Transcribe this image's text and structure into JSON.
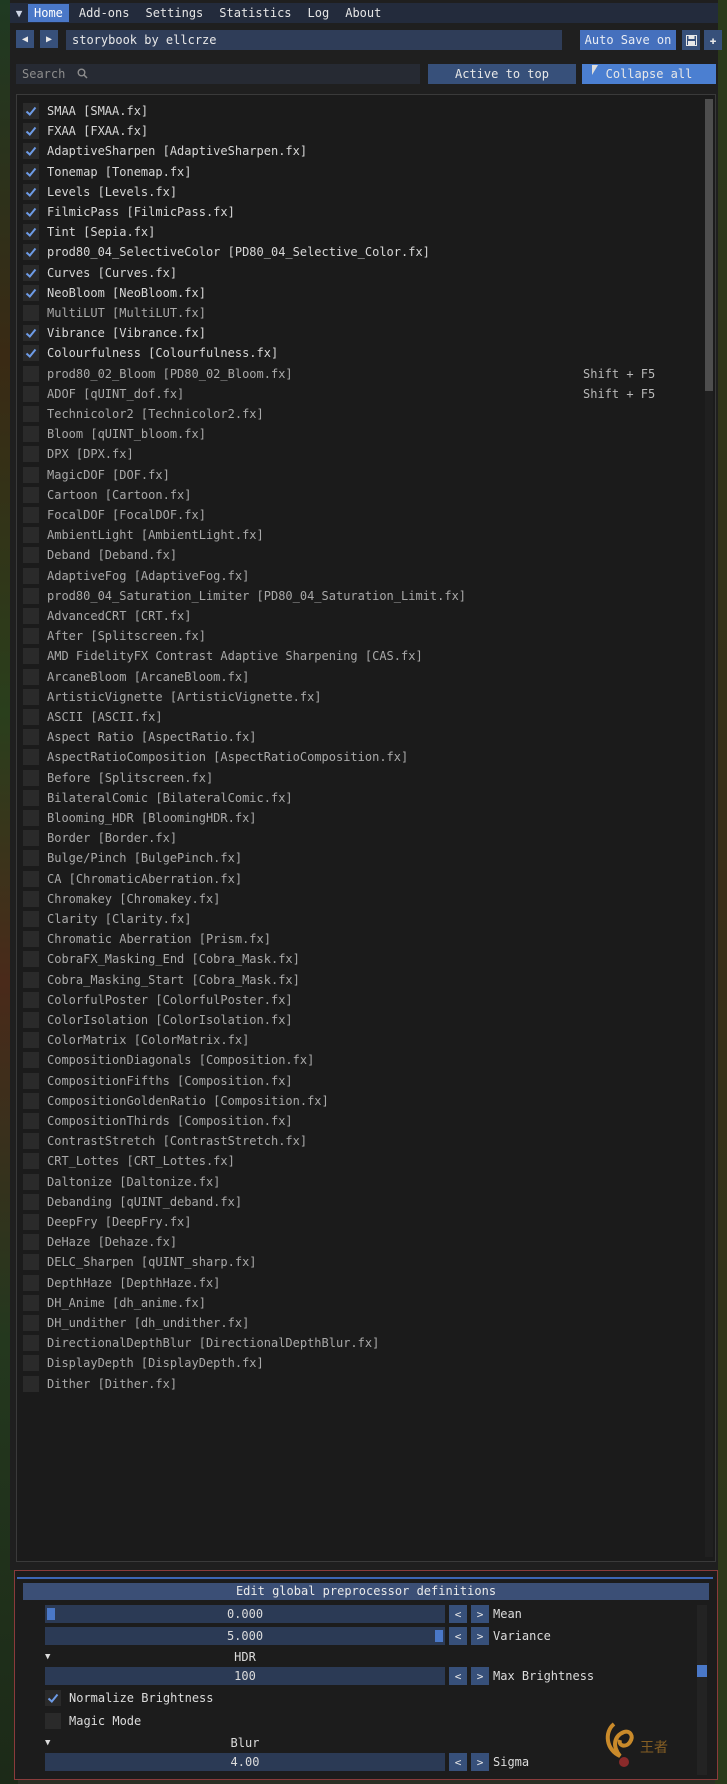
{
  "menu": {
    "items": [
      "Home",
      "Add-ons",
      "Settings",
      "Statistics",
      "Log",
      "About"
    ],
    "active": "Home"
  },
  "preset": {
    "name": "storybook by ellcrze",
    "auto_save": "Auto Save on"
  },
  "toolbar": {
    "search_placeholder": "Search",
    "active_to_top": "Active to top",
    "collapse_all": "Collapse all"
  },
  "effects": [
    {
      "label": "SMAA [SMAA.fx]",
      "checked": true,
      "shortcut": ""
    },
    {
      "label": "FXAA [FXAA.fx]",
      "checked": true,
      "shortcut": ""
    },
    {
      "label": "AdaptiveSharpen [AdaptiveSharpen.fx]",
      "checked": true,
      "shortcut": ""
    },
    {
      "label": "Tonemap [Tonemap.fx]",
      "checked": true,
      "shortcut": ""
    },
    {
      "label": "Levels [Levels.fx]",
      "checked": true,
      "shortcut": ""
    },
    {
      "label": "FilmicPass [FilmicPass.fx]",
      "checked": true,
      "shortcut": ""
    },
    {
      "label": "Tint [Sepia.fx]",
      "checked": true,
      "shortcut": ""
    },
    {
      "label": "prod80_04_SelectiveColor [PD80_04_Selective_Color.fx]",
      "checked": true,
      "shortcut": ""
    },
    {
      "label": "Curves [Curves.fx]",
      "checked": true,
      "shortcut": ""
    },
    {
      "label": "NeoBloom [NeoBloom.fx]",
      "checked": true,
      "shortcut": ""
    },
    {
      "label": "MultiLUT [MultiLUT.fx]",
      "checked": false,
      "shortcut": ""
    },
    {
      "label": "Vibrance [Vibrance.fx]",
      "checked": true,
      "shortcut": ""
    },
    {
      "label": "Colourfulness [Colourfulness.fx]",
      "checked": true,
      "shortcut": ""
    },
    {
      "label": "prod80_02_Bloom [PD80_02_Bloom.fx]",
      "checked": false,
      "shortcut": "Shift + F5"
    },
    {
      "label": "ADOF [qUINT_dof.fx]",
      "checked": false,
      "shortcut": "Shift + F5"
    },
    {
      "label": "Technicolor2 [Technicolor2.fx]",
      "checked": false,
      "shortcut": ""
    },
    {
      "label": "Bloom [qUINT_bloom.fx]",
      "checked": false,
      "shortcut": ""
    },
    {
      "label": "DPX [DPX.fx]",
      "checked": false,
      "shortcut": ""
    },
    {
      "label": "MagicDOF [DOF.fx]",
      "checked": false,
      "shortcut": ""
    },
    {
      "label": "Cartoon [Cartoon.fx]",
      "checked": false,
      "shortcut": ""
    },
    {
      "label": "FocalDOF [FocalDOF.fx]",
      "checked": false,
      "shortcut": ""
    },
    {
      "label": "AmbientLight [AmbientLight.fx]",
      "checked": false,
      "shortcut": ""
    },
    {
      "label": "Deband [Deband.fx]",
      "checked": false,
      "shortcut": ""
    },
    {
      "label": "AdaptiveFog [AdaptiveFog.fx]",
      "checked": false,
      "shortcut": ""
    },
    {
      "label": "prod80_04_Saturation_Limiter [PD80_04_Saturation_Limit.fx]",
      "checked": false,
      "shortcut": ""
    },
    {
      "label": "AdvancedCRT [CRT.fx]",
      "checked": false,
      "shortcut": ""
    },
    {
      "label": "After [Splitscreen.fx]",
      "checked": false,
      "shortcut": ""
    },
    {
      "label": "AMD FidelityFX Contrast Adaptive Sharpening [CAS.fx]",
      "checked": false,
      "shortcut": ""
    },
    {
      "label": "ArcaneBloom [ArcaneBloom.fx]",
      "checked": false,
      "shortcut": ""
    },
    {
      "label": "ArtisticVignette [ArtisticVignette.fx]",
      "checked": false,
      "shortcut": ""
    },
    {
      "label": "ASCII [ASCII.fx]",
      "checked": false,
      "shortcut": ""
    },
    {
      "label": "Aspect Ratio [AspectRatio.fx]",
      "checked": false,
      "shortcut": ""
    },
    {
      "label": "AspectRatioComposition [AspectRatioComposition.fx]",
      "checked": false,
      "shortcut": ""
    },
    {
      "label": "Before [Splitscreen.fx]",
      "checked": false,
      "shortcut": ""
    },
    {
      "label": "BilateralComic [BilateralComic.fx]",
      "checked": false,
      "shortcut": ""
    },
    {
      "label": "Blooming_HDR [BloomingHDR.fx]",
      "checked": false,
      "shortcut": ""
    },
    {
      "label": "Border [Border.fx]",
      "checked": false,
      "shortcut": ""
    },
    {
      "label": "Bulge/Pinch [BulgePinch.fx]",
      "checked": false,
      "shortcut": ""
    },
    {
      "label": "CA [ChromaticAberration.fx]",
      "checked": false,
      "shortcut": ""
    },
    {
      "label": "Chromakey [Chromakey.fx]",
      "checked": false,
      "shortcut": ""
    },
    {
      "label": "Clarity [Clarity.fx]",
      "checked": false,
      "shortcut": ""
    },
    {
      "label": "Chromatic Aberration [Prism.fx]",
      "checked": false,
      "shortcut": ""
    },
    {
      "label": "CobraFX_Masking_End [Cobra_Mask.fx]",
      "checked": false,
      "shortcut": ""
    },
    {
      "label": "Cobra_Masking_Start [Cobra_Mask.fx]",
      "checked": false,
      "shortcut": ""
    },
    {
      "label": "ColorfulPoster [ColorfulPoster.fx]",
      "checked": false,
      "shortcut": ""
    },
    {
      "label": "ColorIsolation [ColorIsolation.fx]",
      "checked": false,
      "shortcut": ""
    },
    {
      "label": "ColorMatrix [ColorMatrix.fx]",
      "checked": false,
      "shortcut": ""
    },
    {
      "label": "CompositionDiagonals [Composition.fx]",
      "checked": false,
      "shortcut": ""
    },
    {
      "label": "CompositionFifths [Composition.fx]",
      "checked": false,
      "shortcut": ""
    },
    {
      "label": "CompositionGoldenRatio [Composition.fx]",
      "checked": false,
      "shortcut": ""
    },
    {
      "label": "CompositionThirds [Composition.fx]",
      "checked": false,
      "shortcut": ""
    },
    {
      "label": "ContrastStretch [ContrastStretch.fx]",
      "checked": false,
      "shortcut": ""
    },
    {
      "label": "CRT_Lottes [CRT_Lottes.fx]",
      "checked": false,
      "shortcut": ""
    },
    {
      "label": "Daltonize [Daltonize.fx]",
      "checked": false,
      "shortcut": ""
    },
    {
      "label": "Debanding [qUINT_deband.fx]",
      "checked": false,
      "shortcut": ""
    },
    {
      "label": "DeepFry [DeepFry.fx]",
      "checked": false,
      "shortcut": ""
    },
    {
      "label": "DeHaze [Dehaze.fx]",
      "checked": false,
      "shortcut": ""
    },
    {
      "label": "DELC_Sharpen [qUINT_sharp.fx]",
      "checked": false,
      "shortcut": ""
    },
    {
      "label": "DepthHaze [DepthHaze.fx]",
      "checked": false,
      "shortcut": ""
    },
    {
      "label": "DH_Anime [dh_anime.fx]",
      "checked": false,
      "shortcut": ""
    },
    {
      "label": "DH_undither [dh_undither.fx]",
      "checked": false,
      "shortcut": ""
    },
    {
      "label": "DirectionalDepthBlur [DirectionalDepthBlur.fx]",
      "checked": false,
      "shortcut": ""
    },
    {
      "label": "DisplayDepth [DisplayDepth.fx]",
      "checked": false,
      "shortcut": ""
    },
    {
      "label": "Dither [Dither.fx]",
      "checked": false,
      "shortcut": ""
    }
  ],
  "bottom": {
    "edit_defs": "Edit global preprocessor definitions",
    "mean": {
      "value": "0.000",
      "label": "Mean"
    },
    "variance": {
      "value": "5.000",
      "label": "Variance"
    },
    "hdr": "HDR",
    "max_brightness": {
      "value": "100",
      "label": "Max Brightness"
    },
    "normalize_brightness": {
      "label": "Normalize Brightness",
      "checked": true
    },
    "magic_mode": {
      "label": "Magic Mode",
      "checked": false
    },
    "blur": "Blur",
    "sigma": {
      "value": "4.00",
      "label": "Sigma"
    }
  },
  "icons": {
    "minus": "<",
    "plus": ">"
  }
}
